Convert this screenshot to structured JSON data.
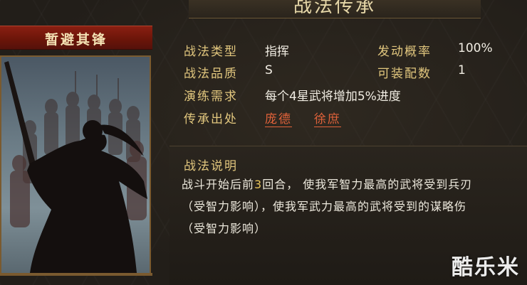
{
  "header": {
    "title": "战法传承"
  },
  "card": {
    "name": "暂避其锋"
  },
  "info": {
    "type_label": "战法类型",
    "type_value": "指挥",
    "rate_label": "发动概率",
    "rate_value": "100%",
    "grade_label": "战法品质",
    "grade_value": "S",
    "equip_label": "可装配数",
    "equip_value": "1",
    "train_label": "演练需求",
    "train_value": "每个4星武将增加5%进度",
    "source_label": "传承出处",
    "source_1": "庞德",
    "source_2": "徐庶"
  },
  "description": {
    "title": "战法说明",
    "line1_a": "战斗开始后前",
    "line1_num": "3",
    "line1_b": "回合，  使我军智力最高的武将受到兵刃",
    "line2": "（受智力影响），使我军武力最高的武将受到的谋略伤",
    "line3": "（受智力影响）"
  },
  "watermark": "酷乐米",
  "colors": {
    "gold": "#e2c77e",
    "link": "#e0623a",
    "banner": "#7a1a0e"
  }
}
